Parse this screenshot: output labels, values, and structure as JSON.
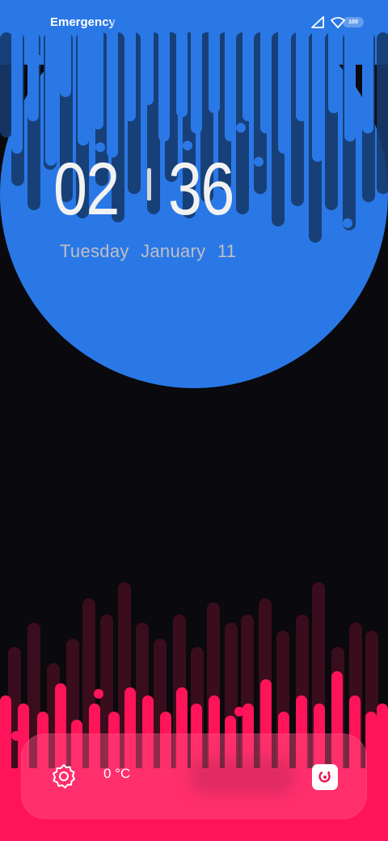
{
  "status_bar": {
    "carrier": "Emergency c",
    "battery_level": "100",
    "icons": [
      "signal-icon",
      "wifi-icon",
      "battery-icon"
    ]
  },
  "clock": {
    "hour": "02",
    "minute": "36"
  },
  "date": {
    "weekday": "Tuesday",
    "month": "January",
    "day": "11"
  },
  "widget": {
    "temperature": "0 °C",
    "left_icon": "settings-icon",
    "right_icon": "camera-shortcut-icon"
  },
  "colors": {
    "top_wave": "#2a78e6",
    "bottom_wave": "#ff1459",
    "background": "#0a090d"
  }
}
